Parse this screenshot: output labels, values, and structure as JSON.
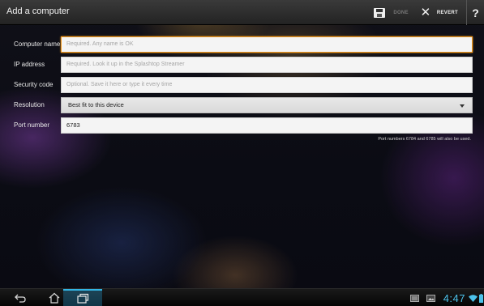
{
  "action_bar": {
    "title": "Add a computer",
    "save_icon": "save-icon",
    "done_label": "DONE",
    "revert_label": "REVERT",
    "help_label": "?"
  },
  "form": {
    "computer_name": {
      "label": "Computer name",
      "placeholder": "Required. Any name is OK",
      "value": ""
    },
    "ip_address": {
      "label": "IP address",
      "placeholder": "Required. Look it up in the Splashtop Streamer",
      "value": ""
    },
    "security_code": {
      "label": "Security code",
      "placeholder": "Optional. Save it here or type it every time",
      "value": ""
    },
    "resolution": {
      "label": "Resolution",
      "selected": "Best fit to this device"
    },
    "port_number": {
      "label": "Port number",
      "value": "6783"
    },
    "port_hint": "Port numbers 6784 and 6785 will also be used."
  },
  "system_bar": {
    "clock": "4:47",
    "icons": [
      "back-icon",
      "home-icon",
      "recent-apps-icon",
      "screenshot-icon",
      "gallery-icon",
      "wifi-icon",
      "battery-icon"
    ]
  },
  "colors": {
    "accent_focus": "#f39a1e",
    "clock": "#4cc2ea",
    "recent_highlight": "#33b5e5"
  }
}
